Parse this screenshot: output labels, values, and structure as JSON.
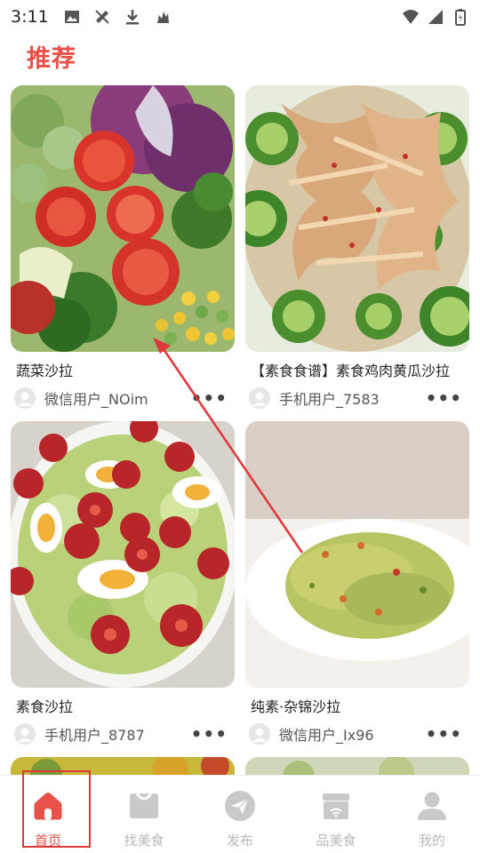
{
  "status_bar": {
    "time": "3:11"
  },
  "page": {
    "title": "推荐"
  },
  "feed": {
    "left": [
      {
        "title": "蔬菜沙拉",
        "user": "微信用户_NOim"
      },
      {
        "title": "素食沙拉",
        "user": "手机用户_8787"
      }
    ],
    "right": [
      {
        "title": "【素食食谱】素食鸡肉黄瓜沙拉",
        "user": "手机用户_7583"
      },
      {
        "title": "纯素·杂锦沙拉",
        "user": "微信用户_Ix96"
      }
    ],
    "more_label": "•••"
  },
  "nav": {
    "items": [
      {
        "label": "首页",
        "icon": "home-icon",
        "active": true
      },
      {
        "label": "找美食",
        "icon": "bag-icon",
        "active": false
      },
      {
        "label": "发布",
        "icon": "send-icon",
        "active": false
      },
      {
        "label": "品美食",
        "icon": "shop-icon",
        "active": false
      },
      {
        "label": "我的",
        "icon": "user-icon",
        "active": false
      }
    ]
  },
  "colors": {
    "accent": "#e8504a",
    "nav_inactive": "#b9b9b9",
    "annotation": "#e0383a"
  }
}
